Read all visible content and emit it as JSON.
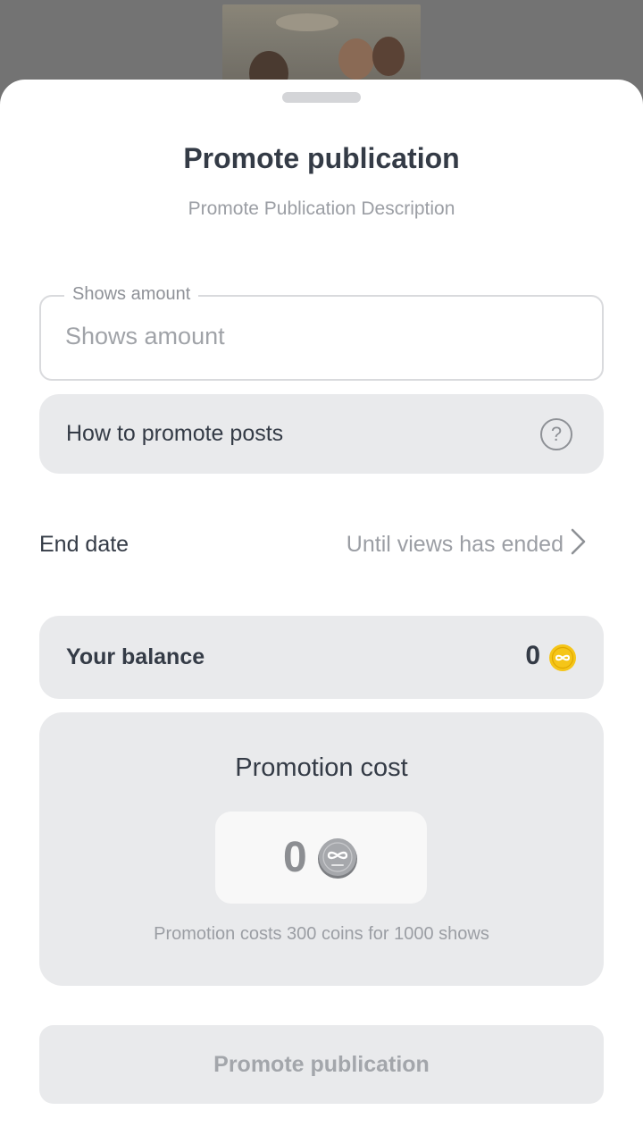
{
  "sheet": {
    "title": "Promote publication",
    "subtitle": "Promote Publication Description"
  },
  "shows_field": {
    "legend": "Shows amount",
    "placeholder": "Shows amount",
    "value": ""
  },
  "how_to": {
    "label": "How to promote posts",
    "icon": "help-circle-icon",
    "icon_glyph": "?"
  },
  "end_date": {
    "label": "End date",
    "value": "Until views has ended",
    "icon": "chevron-right-icon"
  },
  "balance": {
    "label": "Your balance",
    "value": "0",
    "icon": "gold-coin-icon",
    "coin_color": "#f5c518"
  },
  "promotion_cost": {
    "title": "Promotion cost",
    "value": "0",
    "icon": "grey-coin-icon",
    "note": "Promotion costs 300 coins for 1000 shows"
  },
  "promote_button": {
    "label": "Promote publication",
    "enabled": false
  },
  "colors": {
    "text_primary": "#343b46",
    "text_secondary": "#9b9ea4",
    "card_bg": "#e9eaec",
    "accent_coin": "#f5c518"
  }
}
